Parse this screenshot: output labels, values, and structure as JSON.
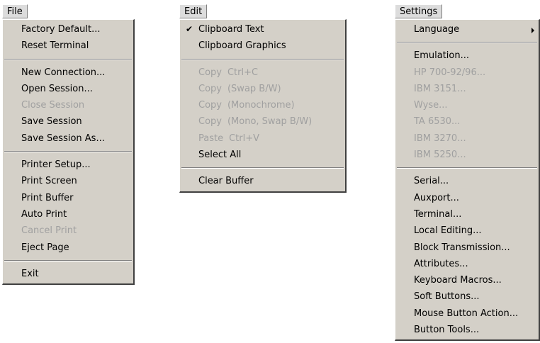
{
  "menus": {
    "file": {
      "title": "File",
      "items": {
        "factory_default": "Factory Default...",
        "reset_terminal": "Reset Terminal",
        "new_connection": "New Connection...",
        "open_session": "Open Session...",
        "close_session": "Close Session",
        "save_session": "Save Session",
        "save_session_as": "Save Session As...",
        "printer_setup": "Printer Setup...",
        "print_screen": "Print Screen",
        "print_buffer": "Print Buffer",
        "auto_print": "Auto Print",
        "cancel_print": "Cancel Print",
        "eject_page": "Eject Page",
        "exit": "Exit"
      }
    },
    "edit": {
      "title": "Edit",
      "items": {
        "clipboard_text": "Clipboard Text",
        "clipboard_text_check": "✔",
        "clipboard_graphics": "Clipboard Graphics",
        "copy": "Copy",
        "copy_shortcut": "Ctrl+C",
        "copy_swap_bw": "Copy",
        "copy_swap_bw_suffix": "(Swap B/W)",
        "copy_monochrome": "Copy",
        "copy_monochrome_suffix": "(Monochrome)",
        "copy_mono_swap": "Copy",
        "copy_mono_swap_suffix": "(Mono, Swap B/W)",
        "paste": "Paste",
        "paste_shortcut": "Ctrl+V",
        "select_all": "Select All",
        "clear_buffer": "Clear Buffer"
      }
    },
    "settings": {
      "title": "Settings",
      "items": {
        "language": "Language",
        "emulation": "Emulation...",
        "hp_700": "HP 700-92/96...",
        "ibm_3151": "IBM 3151...",
        "wyse": "Wyse...",
        "ta_6530": "TA 6530...",
        "ibm_3270": "IBM 3270...",
        "ibm_5250": "IBM 5250...",
        "serial": "Serial...",
        "auxport": "Auxport...",
        "terminal": "Terminal...",
        "local_editing": "Local Editing...",
        "block_transmission": "Block Transmission...",
        "attributes": "Attributes...",
        "keyboard_macros": "Keyboard Macros...",
        "soft_buttons": "Soft Buttons...",
        "mouse_button_action": "Mouse Button Action...",
        "button_tools": "Button Tools..."
      }
    }
  }
}
